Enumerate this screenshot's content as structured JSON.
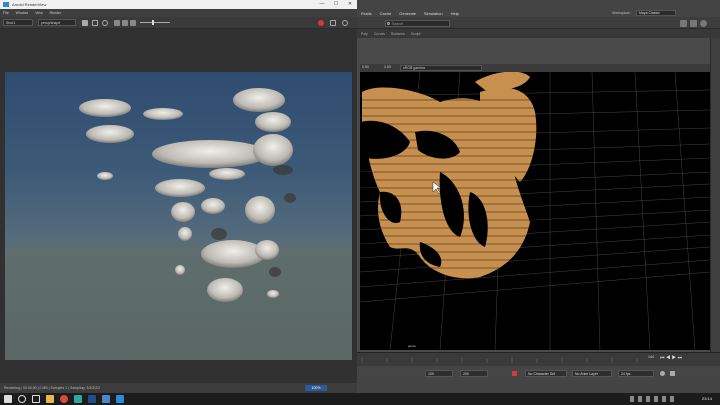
{
  "render_view": {
    "title": "Arnold RenderView",
    "menu": [
      "File",
      "Window",
      "View",
      "Render"
    ],
    "camera_select": "Shot1",
    "aov_select": "persp/shape",
    "status_text": "Rendering | 00:00:00 | 0 MB | Samples 1 | Sampling: 3/2/2/2/2",
    "zoom_label": "100%"
  },
  "maya": {
    "menu": [
      "Fluids",
      "Cache",
      "Generate",
      "Simulation",
      "Help"
    ],
    "workspace_label": "Workspace:",
    "workspace_value": "Maya Classic",
    "shelf_tabs": [
      "Poly",
      "Curves",
      "Surfaces",
      "Sculpt"
    ],
    "search_placeholder": "Search",
    "viewport_shading": "sRGB gamma",
    "viewport_toolbar_values": [
      "0.00",
      "1.00"
    ],
    "persp_label": "persp",
    "current_time": "144",
    "range_fields": [
      "100",
      "200"
    ],
    "character_set": "No Character Set",
    "anim_layer": "No Anim Layer",
    "fps": "24 fps"
  },
  "taskbar": {
    "time": "23:14"
  },
  "colors": {
    "accent_blue": "#2a8bd6",
    "particle_orange": "#c8904e",
    "record_red": "#d23a3a"
  }
}
